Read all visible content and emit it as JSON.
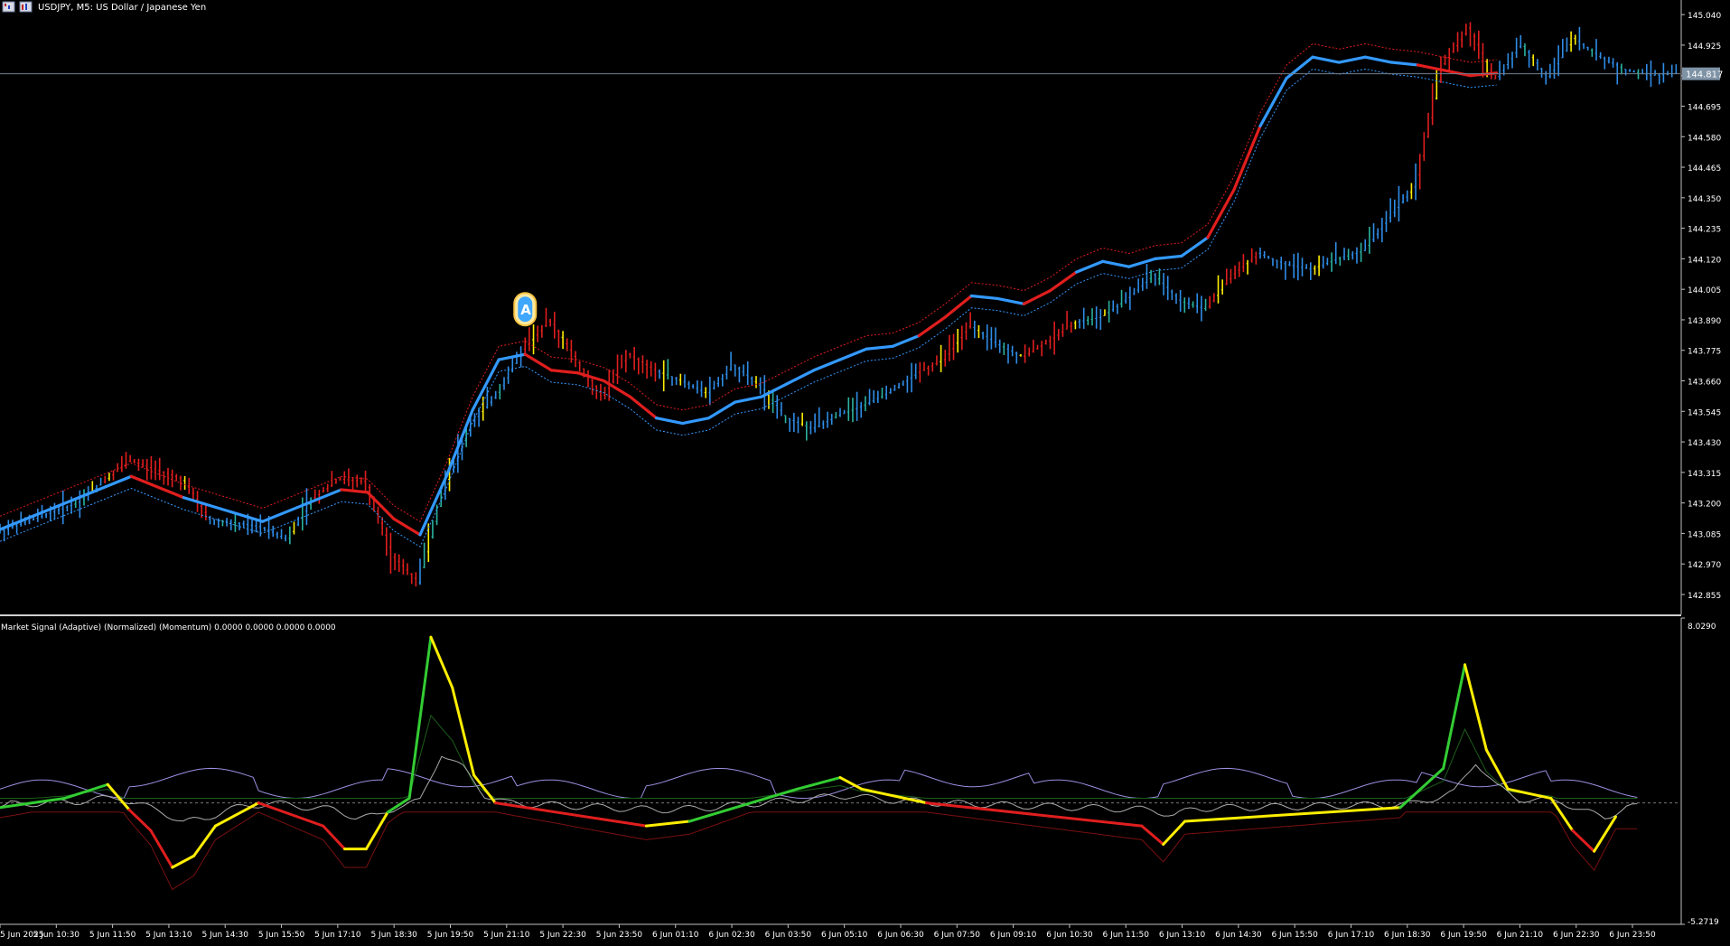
{
  "header": {
    "title": "USDJPY, M5:  US Dollar / Japanese Yen"
  },
  "indicator": {
    "label": "Market Signal (Adaptive) (Normalized) (Momentum) 0.0000 0.0000 0.0000 0.0000"
  },
  "colors": {
    "background": "#000000",
    "bull": "#2f8ce6",
    "bull_light": "#4aa8ff",
    "bear": "#e01e1e",
    "neutral": "#ffee00",
    "teal": "#2bb3a0",
    "ma_line": "#3399ff",
    "green": "#33cc33",
    "dark_green": "#1b5e1b",
    "dark_red": "#7a1010",
    "lavender": "#9a8fe0",
    "gray": "#aaaaaa",
    "current_price_bg": "#7f93a6"
  },
  "current_price": "144.817",
  "chart_data": [
    {
      "type": "candlestick",
      "symbol": "USDJPY",
      "timeframe": "M5",
      "title": "USDJPY, M5:  US Dollar / Japanese Yen",
      "y_ticks": [
        "145.040",
        "144.925",
        "144.810",
        "144.695",
        "144.580",
        "144.465",
        "144.350",
        "144.235",
        "144.120",
        "144.005",
        "143.890",
        "143.775",
        "143.660",
        "143.545",
        "143.430",
        "143.315",
        "143.200",
        "143.085",
        "142.970",
        "142.855"
      ],
      "ylim": [
        142.78,
        145.095
      ],
      "current_price": 144.817,
      "x_labels": [
        "5 Jun 2025",
        "5 Jun 10:30",
        "5 Jun 11:50",
        "5 Jun 13:10",
        "5 Jun 14:30",
        "5 Jun 15:50",
        "5 Jun 17:10",
        "5 Jun 18:30",
        "5 Jun 19:50",
        "5 Jun 21:10",
        "5 Jun 22:30",
        "5 Jun 23:50",
        "6 Jun 01:10",
        "6 Jun 02:30",
        "6 Jun 03:50",
        "6 Jun 05:10",
        "6 Jun 06:30",
        "6 Jun 07:50",
        "6 Jun 09:10",
        "6 Jun 10:30",
        "6 Jun 11:50",
        "6 Jun 13:10",
        "6 Jun 14:30",
        "6 Jun 15:50",
        "6 Jun 17:10",
        "6 Jun 18:30",
        "6 Jun 19:50",
        "6 Jun 21:10",
        "6 Jun 22:30",
        "6 Jun 23:50"
      ],
      "price_path": [
        [
          0,
          143.09
        ],
        [
          3,
          143.2
        ],
        [
          5,
          143.36
        ],
        [
          7,
          143.29
        ],
        [
          8,
          143.14
        ],
        [
          10,
          143.11
        ],
        [
          11,
          143.06
        ],
        [
          12,
          143.22
        ],
        [
          13,
          143.29
        ],
        [
          14,
          143.28
        ],
        [
          15,
          143.0
        ],
        [
          16,
          142.9
        ],
        [
          17,
          143.26
        ],
        [
          18,
          143.5
        ],
        [
          19,
          143.61
        ],
        [
          20,
          143.78
        ],
        [
          21,
          143.89
        ],
        [
          22,
          143.74
        ],
        [
          23,
          143.6
        ],
        [
          24,
          143.76
        ],
        [
          25,
          143.7
        ],
        [
          26,
          143.66
        ],
        [
          27,
          143.61
        ],
        [
          28,
          143.72
        ],
        [
          29,
          143.64
        ],
        [
          30,
          143.52
        ],
        [
          31,
          143.48
        ],
        [
          32,
          143.53
        ],
        [
          33,
          143.57
        ],
        [
          34,
          143.62
        ],
        [
          35,
          143.69
        ],
        [
          36,
          143.74
        ],
        [
          37,
          143.87
        ],
        [
          38,
          143.8
        ],
        [
          39,
          143.75
        ],
        [
          40,
          143.81
        ],
        [
          41,
          143.88
        ],
        [
          42,
          143.9
        ],
        [
          43,
          143.97
        ],
        [
          44,
          144.06
        ],
        [
          45,
          143.96
        ],
        [
          46,
          143.93
        ],
        [
          47,
          144.06
        ],
        [
          48,
          144.14
        ],
        [
          49,
          144.1
        ],
        [
          50,
          144.08
        ],
        [
          51,
          144.12
        ],
        [
          52,
          144.15
        ],
        [
          53,
          144.28
        ],
        [
          54,
          144.4
        ],
        [
          55,
          144.85
        ],
        [
          56,
          144.99
        ],
        [
          57,
          144.79
        ],
        [
          58,
          144.93
        ],
        [
          59,
          144.8
        ],
        [
          60,
          144.95
        ],
        [
          61,
          144.88
        ],
        [
          62,
          144.83
        ],
        [
          63,
          144.81
        ],
        [
          64,
          144.82
        ]
      ],
      "moving_average_path": [
        [
          0,
          143.1
        ],
        [
          5,
          143.3
        ],
        [
          7,
          143.22
        ],
        [
          10,
          143.13
        ],
        [
          13,
          143.25
        ],
        [
          14,
          143.24
        ],
        [
          15,
          143.14
        ],
        [
          16,
          143.08
        ],
        [
          17,
          143.3
        ],
        [
          18,
          143.55
        ],
        [
          19,
          143.74
        ],
        [
          20,
          143.76
        ],
        [
          21,
          143.7
        ],
        [
          22,
          143.69
        ],
        [
          23,
          143.66
        ],
        [
          24,
          143.6
        ],
        [
          25,
          143.52
        ],
        [
          26,
          143.5
        ],
        [
          27,
          143.52
        ],
        [
          28,
          143.58
        ],
        [
          29,
          143.6
        ],
        [
          30,
          143.65
        ],
        [
          31,
          143.7
        ],
        [
          32,
          143.74
        ],
        [
          33,
          143.78
        ],
        [
          34,
          143.79
        ],
        [
          35,
          143.83
        ],
        [
          36,
          143.9
        ],
        [
          37,
          143.98
        ],
        [
          38,
          143.97
        ],
        [
          39,
          143.95
        ],
        [
          40,
          144.0
        ],
        [
          41,
          144.07
        ],
        [
          42,
          144.11
        ],
        [
          43,
          144.09
        ],
        [
          44,
          144.12
        ],
        [
          45,
          144.13
        ],
        [
          46,
          144.2
        ],
        [
          47,
          144.38
        ],
        [
          48,
          144.62
        ],
        [
          49,
          144.8
        ],
        [
          50,
          144.88
        ],
        [
          51,
          144.86
        ],
        [
          52,
          144.88
        ],
        [
          53,
          144.86
        ],
        [
          54,
          144.85
        ],
        [
          55,
          144.83
        ],
        [
          56,
          144.81
        ],
        [
          57,
          144.82
        ]
      ],
      "regime_segments": [
        {
          "from": 0,
          "to": 4,
          "regime": "bull"
        },
        {
          "from": 4,
          "to": 8,
          "regime": "bear"
        },
        {
          "from": 8,
          "to": 12,
          "regime": "bull"
        },
        {
          "from": 12,
          "to": 16,
          "regime": "bear"
        },
        {
          "from": 16,
          "to": 20,
          "regime": "bull"
        },
        {
          "from": 20,
          "to": 25,
          "regime": "bear"
        },
        {
          "from": 25,
          "to": 35,
          "regime": "bull"
        },
        {
          "from": 35,
          "to": 37,
          "regime": "bear"
        },
        {
          "from": 37,
          "to": 39,
          "regime": "bull"
        },
        {
          "from": 39,
          "to": 41,
          "regime": "bear"
        },
        {
          "from": 41,
          "to": 46,
          "regime": "bull"
        },
        {
          "from": 46,
          "to": 48,
          "regime": "bear"
        },
        {
          "from": 48,
          "to": 54,
          "regime": "bull"
        },
        {
          "from": 54,
          "to": 57,
          "regime": "bear"
        }
      ],
      "signal_marker": {
        "label": "A",
        "at": 20,
        "price": 143.93
      }
    },
    {
      "type": "line",
      "title": "Market Signal (Adaptive) (Normalized) (Momentum)",
      "values_printed": [
        0.0,
        0.0,
        0.0,
        0.0
      ],
      "y_ticks": [
        "8.0290",
        "-5.2719"
      ],
      "ylim": [
        -5.2719,
        8.029
      ],
      "zero_line": 0,
      "series_main": [
        [
          0,
          -0.2
        ],
        [
          3,
          0.2
        ],
        [
          5,
          0.8
        ],
        [
          6,
          -0.3
        ],
        [
          7,
          -1.2
        ],
        [
          8,
          -2.8
        ],
        [
          9,
          -2.3
        ],
        [
          10,
          -1.0
        ],
        [
          12,
          0.0
        ],
        [
          15,
          -1.0
        ],
        [
          16,
          -2.0
        ],
        [
          17,
          -2.0
        ],
        [
          18,
          -0.4
        ],
        [
          19,
          0.2
        ],
        [
          20,
          7.2
        ],
        [
          21,
          5.0
        ],
        [
          22,
          1.2
        ],
        [
          23,
          0.0
        ],
        [
          30,
          -1.0
        ],
        [
          32,
          -0.8
        ],
        [
          37,
          0.6
        ],
        [
          39,
          1.1
        ],
        [
          40,
          0.6
        ],
        [
          43,
          0.0
        ],
        [
          53,
          -1.0
        ],
        [
          54,
          -1.8
        ],
        [
          55,
          -0.8
        ],
        [
          65,
          -0.2
        ],
        [
          67,
          1.5
        ],
        [
          68,
          6.0
        ],
        [
          69,
          2.3
        ],
        [
          70,
          0.6
        ],
        [
          72,
          0.2
        ],
        [
          73,
          -1.2
        ],
        [
          74,
          -2.1
        ],
        [
          75,
          -0.6
        ]
      ]
    }
  ]
}
